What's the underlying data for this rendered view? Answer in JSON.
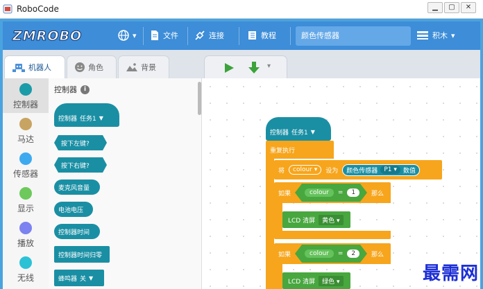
{
  "window": {
    "title": "RoboCode",
    "min_icon": "minimize-glyph",
    "max_icon": "maximize-glyph",
    "close_icon": "close-glyph"
  },
  "toolbar": {
    "logo": "ZMROBO",
    "language_icon": "globe-icon",
    "file_label": "文件",
    "connect_label": "连接",
    "tutorial_label": "教程",
    "project_name": "颜色传感器",
    "blocks_label": "积木"
  },
  "tabs": {
    "robot": "机器人",
    "character": "角色",
    "background": "背景"
  },
  "categories": [
    {
      "label": "控制器",
      "color": "#1a9ba8"
    },
    {
      "label": "马达",
      "color": "#c8a462"
    },
    {
      "label": "传感器",
      "color": "#3daaf0"
    },
    {
      "label": "显示",
      "color": "#6dc95b"
    },
    {
      "label": "播放",
      "color": "#7c82f0"
    },
    {
      "label": "无线",
      "color": "#2cc2d6"
    }
  ],
  "palette": {
    "title": "控制器",
    "blocks": {
      "controller_task": "控制器",
      "task_value": "任务1",
      "left_key": "按下左键?",
      "right_key": "按下右键?",
      "mic_volume": "麦克风音量",
      "battery": "电池电压",
      "controller_time": "控制器时间",
      "time_reset": "控制器时间归零",
      "buzzer": "蜂鸣器",
      "buzzer_value": "关"
    }
  },
  "workspace": {
    "hat_label": "控制器",
    "hat_task": "任务1",
    "repeat": "重复执行",
    "set_prefix": "将",
    "var_name": "colour",
    "set_to": "设为",
    "sensor_label": "颜色传感器",
    "sensor_port": "P1",
    "sensor_value": "数值",
    "if1": "如果",
    "eq": "=",
    "num1": "1",
    "then1": "那么",
    "lcd1_label": "LCD 清屏",
    "lcd1_color": "黄色",
    "if2": "如果",
    "num2": "2",
    "then2": "那么",
    "lcd2_label": "LCD 清屏",
    "lcd2_color": "绿色"
  },
  "watermark": "最需网"
}
